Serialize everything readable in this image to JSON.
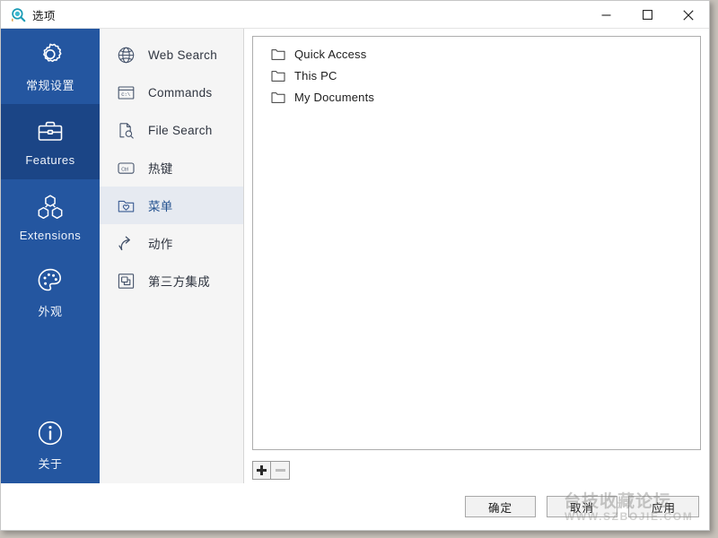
{
  "window": {
    "title": "选项",
    "app_icon": "search-magnifier-icon",
    "controls": {
      "minimize": "minimize-icon",
      "maximize": "maximize-icon",
      "close": "close-icon"
    }
  },
  "sidebar": {
    "accent_color": "#2456a0",
    "selected_color": "#1b4586",
    "items": [
      {
        "label": "常规设置",
        "icon": "gear-icon",
        "selected": false
      },
      {
        "label": "Features",
        "icon": "briefcase-icon",
        "selected": true
      },
      {
        "label": "Extensions",
        "icon": "modules-icon",
        "selected": false
      },
      {
        "label": "外观",
        "icon": "palette-icon",
        "selected": false
      }
    ],
    "bottom_item": {
      "label": "关于",
      "icon": "info-icon",
      "selected": false
    }
  },
  "nav_mid": {
    "background": "#f5f5f5",
    "selected_background": "#e6eaf1",
    "selected_text_color": "#23518f",
    "items": [
      {
        "label": "Web Search",
        "icon": "globe-icon",
        "selected": false
      },
      {
        "label": "Commands",
        "icon": "console-window-icon",
        "selected": false
      },
      {
        "label": "File Search",
        "icon": "file-search-icon",
        "selected": false
      },
      {
        "label": "热键",
        "icon": "ctrl-key-icon",
        "selected": false
      },
      {
        "label": "菜单",
        "icon": "folder-heart-icon",
        "selected": true
      },
      {
        "label": "动作",
        "icon": "share-arrow-icon",
        "selected": false
      },
      {
        "label": "第三方集成",
        "icon": "windows-stack-icon",
        "selected": false
      }
    ]
  },
  "main": {
    "list": [
      {
        "label": "Quick Access",
        "icon": "folder-icon"
      },
      {
        "label": "This PC",
        "icon": "folder-icon"
      },
      {
        "label": "My Documents",
        "icon": "folder-icon"
      }
    ],
    "add_button": {
      "glyph": "plus-icon",
      "enabled": true
    },
    "remove_button": {
      "glyph": "minus-icon",
      "enabled": false
    }
  },
  "footer": {
    "ok_label": "确定",
    "cancel_label": "取消",
    "apply_label": "应用"
  },
  "watermark": {
    "text_cn": "台技收藏论坛",
    "text_url": "WWW.SZBOJIE.COM"
  }
}
